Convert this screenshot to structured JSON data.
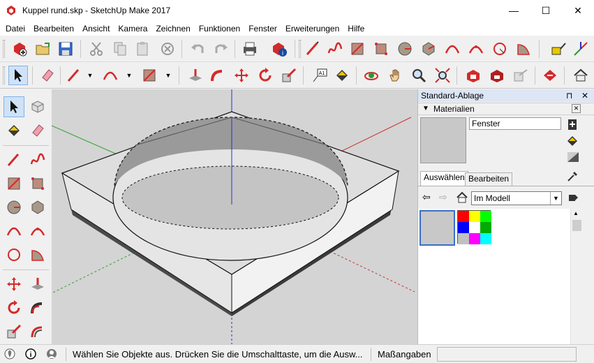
{
  "window": {
    "title": "Kuppel rund.skp - SketchUp Make 2017",
    "minimize": "—",
    "maximize": "☐",
    "close": "✕"
  },
  "menu": [
    "Datei",
    "Bearbeiten",
    "Ansicht",
    "Kamera",
    "Zeichnen",
    "Funktionen",
    "Fenster",
    "Erweiterungen",
    "Hilfe"
  ],
  "toolbar1": [
    "new-icon",
    "open-icon",
    "save-icon",
    "cut-icon",
    "copy-icon",
    "paste-icon",
    "erase-icon",
    "undo-icon",
    "redo-icon",
    "print-icon",
    "model-info-icon",
    "line-icon",
    "freehand-icon",
    "rectangle-icon",
    "rotated-rectangle-icon",
    "circle-icon",
    "polygon-icon",
    "arc-icon",
    "two-point-arc-icon",
    "three-point-arc-icon",
    "pie-icon",
    "tape-measure-icon",
    "axes-icon"
  ],
  "toolbar2": [
    "select-icon",
    "eraser-icon",
    "pencil-icon",
    "arc-icon",
    "rectangle-icon",
    "push-pull-icon",
    "follow-me-icon",
    "move-icon",
    "rotate-icon",
    "scale-icon",
    "text-icon",
    "paint-bucket-icon",
    "orbit-icon",
    "pan-icon",
    "zoom-icon",
    "zoom-extents-icon",
    "warehouse-icon",
    "extension-warehouse-icon",
    "share-icon",
    "send-icon",
    "house-icon"
  ],
  "tray": {
    "title": "Standard-Ablage",
    "pin": "⊓",
    "close": "✕",
    "panel_title": "Materialien",
    "panel_close": "✕",
    "material_name": "Fenster",
    "tabs": [
      "Auswählen",
      "Bearbeiten"
    ],
    "library": "Im Modell",
    "swatch_colors": [
      "#ff0000",
      "#ffff00",
      "#00ff00",
      "#0000ff",
      "#ffffff",
      "#00ffff",
      "#000000",
      "#c0c0c0",
      "#ff00ff",
      "#00ffff"
    ]
  },
  "status": {
    "text": "Wählen Sie Objekte aus. Drücken Sie die Umschalttaste, um die Ausw...",
    "measure_label": "Maßangaben",
    "measure_value": ""
  },
  "colors": {
    "sketchup_red": "#d42a2a",
    "accent_blue": "#3a6ec8",
    "axis_red": "#d03030",
    "axis_green": "#30a030",
    "axis_blue": "#3030c8"
  }
}
